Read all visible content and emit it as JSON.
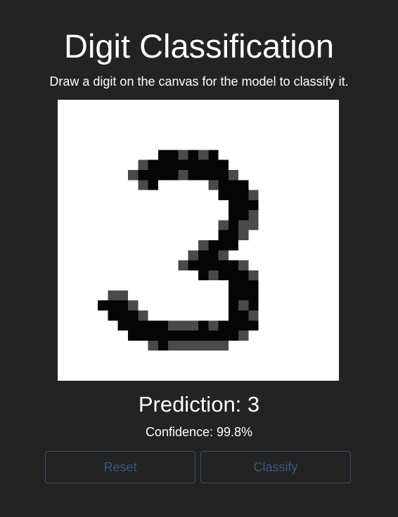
{
  "page": {
    "title": "Digit Classification",
    "subtitle": "Draw a digit on the canvas for the model to classify it."
  },
  "result": {
    "prediction_label": "Prediction: 3",
    "confidence_label": "Confidence: 99.8%"
  },
  "buttons": {
    "reset_label": "Reset",
    "classify_label": "Classify",
    "disabled_color": "#3f5878"
  },
  "canvas": {
    "grid_size": 28,
    "background": "#ffffff",
    "drawn_digit": "3",
    "pixels": [
      [
        10,
        5,
        0
      ],
      [
        11,
        5,
        0
      ],
      [
        12,
        5,
        1
      ],
      [
        13,
        5,
        0
      ],
      [
        14,
        5,
        1
      ],
      [
        15,
        5,
        0
      ],
      [
        8,
        6,
        1
      ],
      [
        9,
        6,
        0
      ],
      [
        10,
        6,
        0
      ],
      [
        11,
        6,
        0
      ],
      [
        12,
        6,
        0
      ],
      [
        13,
        6,
        0
      ],
      [
        14,
        6,
        0
      ],
      [
        15,
        6,
        0
      ],
      [
        16,
        6,
        0
      ],
      [
        7,
        7,
        1
      ],
      [
        8,
        7,
        0
      ],
      [
        9,
        7,
        0
      ],
      [
        10,
        7,
        0
      ],
      [
        11,
        7,
        0
      ],
      [
        12,
        7,
        1
      ],
      [
        13,
        7,
        0
      ],
      [
        14,
        7,
        0
      ],
      [
        15,
        7,
        0
      ],
      [
        16,
        7,
        0
      ],
      [
        17,
        7,
        1
      ],
      [
        8,
        8,
        1
      ],
      [
        9,
        8,
        0
      ],
      [
        15,
        8,
        1
      ],
      [
        16,
        8,
        0
      ],
      [
        17,
        8,
        0
      ],
      [
        18,
        8,
        0
      ],
      [
        16,
        9,
        0
      ],
      [
        17,
        9,
        0
      ],
      [
        18,
        9,
        0
      ],
      [
        19,
        9,
        1
      ],
      [
        17,
        10,
        0
      ],
      [
        18,
        10,
        0
      ],
      [
        19,
        10,
        0
      ],
      [
        17,
        11,
        0
      ],
      [
        18,
        11,
        0
      ],
      [
        19,
        11,
        1
      ],
      [
        16,
        12,
        1
      ],
      [
        17,
        12,
        0
      ],
      [
        18,
        12,
        1
      ],
      [
        19,
        12,
        1
      ],
      [
        16,
        13,
        0
      ],
      [
        17,
        13,
        0
      ],
      [
        18,
        13,
        1
      ],
      [
        14,
        14,
        1
      ],
      [
        15,
        14,
        0
      ],
      [
        16,
        14,
        0
      ],
      [
        17,
        14,
        0
      ],
      [
        13,
        15,
        1
      ],
      [
        14,
        15,
        0
      ],
      [
        15,
        15,
        0
      ],
      [
        16,
        15,
        1
      ],
      [
        12,
        16,
        1
      ],
      [
        13,
        16,
        0
      ],
      [
        14,
        16,
        0
      ],
      [
        15,
        16,
        0
      ],
      [
        16,
        16,
        0
      ],
      [
        17,
        16,
        0
      ],
      [
        18,
        16,
        1
      ],
      [
        14,
        17,
        0
      ],
      [
        15,
        17,
        1
      ],
      [
        16,
        17,
        0
      ],
      [
        17,
        17,
        0
      ],
      [
        18,
        17,
        0
      ],
      [
        19,
        17,
        1
      ],
      [
        17,
        18,
        0
      ],
      [
        18,
        18,
        0
      ],
      [
        19,
        18,
        0
      ],
      [
        5,
        19,
        1
      ],
      [
        6,
        19,
        1
      ],
      [
        17,
        19,
        0
      ],
      [
        18,
        19,
        0
      ],
      [
        19,
        19,
        0
      ],
      [
        4,
        20,
        0
      ],
      [
        5,
        20,
        0
      ],
      [
        6,
        20,
        0
      ],
      [
        7,
        20,
        1
      ],
      [
        17,
        20,
        0
      ],
      [
        18,
        20,
        1
      ],
      [
        19,
        20,
        0
      ],
      [
        5,
        21,
        0
      ],
      [
        6,
        21,
        0
      ],
      [
        7,
        21,
        0
      ],
      [
        8,
        21,
        1
      ],
      [
        17,
        21,
        0
      ],
      [
        18,
        21,
        0
      ],
      [
        19,
        21,
        1
      ],
      [
        6,
        22,
        0
      ],
      [
        7,
        22,
        0
      ],
      [
        8,
        22,
        0
      ],
      [
        9,
        22,
        0
      ],
      [
        10,
        22,
        0
      ],
      [
        11,
        22,
        1
      ],
      [
        12,
        22,
        1
      ],
      [
        13,
        22,
        1
      ],
      [
        14,
        22,
        0
      ],
      [
        15,
        22,
        1
      ],
      [
        16,
        22,
        0
      ],
      [
        17,
        22,
        0
      ],
      [
        18,
        22,
        0
      ],
      [
        19,
        22,
        0
      ],
      [
        7,
        23,
        0
      ],
      [
        8,
        23,
        0
      ],
      [
        9,
        23,
        0
      ],
      [
        10,
        23,
        0
      ],
      [
        11,
        23,
        0
      ],
      [
        12,
        23,
        0
      ],
      [
        13,
        23,
        0
      ],
      [
        14,
        23,
        0
      ],
      [
        15,
        23,
        0
      ],
      [
        16,
        23,
        0
      ],
      [
        17,
        23,
        0
      ],
      [
        18,
        23,
        1
      ],
      [
        9,
        24,
        1
      ],
      [
        10,
        24,
        0
      ],
      [
        11,
        24,
        1
      ],
      [
        12,
        24,
        1
      ],
      [
        13,
        24,
        1
      ],
      [
        14,
        24,
        1
      ],
      [
        15,
        24,
        1
      ],
      [
        16,
        24,
        1
      ]
    ],
    "shades": [
      "#050505",
      "#4a4a4a"
    ]
  }
}
